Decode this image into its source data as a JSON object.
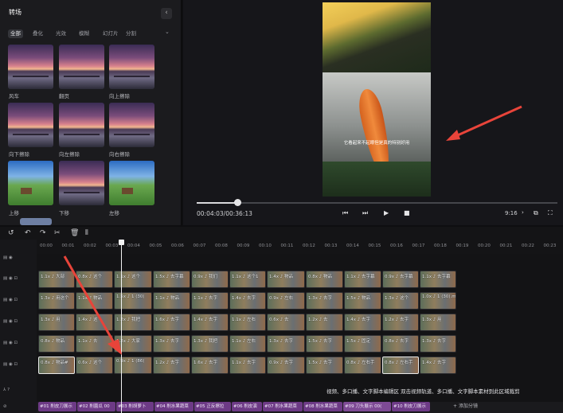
{
  "transitions_panel": {
    "title": "转场",
    "categories": [
      "全部",
      "叠化",
      "光效",
      "模糊",
      "幻灯片",
      "分割"
    ],
    "items": [
      {
        "label": "风车",
        "style": "sunset"
      },
      {
        "label": "翻页",
        "style": "sunset"
      },
      {
        "label": "向上擦除",
        "style": "sunset"
      },
      {
        "label": "向下擦除",
        "style": "sunset"
      },
      {
        "label": "向左擦除",
        "style": "sunset"
      },
      {
        "label": "向右擦除",
        "style": "sunset"
      },
      {
        "label": "上移",
        "style": "green"
      },
      {
        "label": "下移",
        "style": "sunset"
      },
      {
        "label": "左移",
        "style": "green"
      }
    ]
  },
  "preview": {
    "subtitle": "它看起来不起眼但是真的特别好用",
    "progress_fraction": 0.113,
    "time": "00:04:03/00:36:13",
    "ratio": "9:16",
    "arrow_color": "#e8443a"
  },
  "toolbar": {
    "icons": [
      "undo-icon",
      "undo-icon",
      "redo-icon",
      "cut-icon",
      "delete-icon",
      "split-icon"
    ]
  },
  "ruler": {
    "ticks": [
      "00:00",
      "00:01",
      "00:02",
      "00:03",
      "00:04",
      "00:05",
      "00:06",
      "00:07",
      "00:08",
      "00:09",
      "00:10",
      "00:11",
      "00:12",
      "00:13",
      "00:14",
      "00:15",
      "00:16",
      "00:17",
      "00:18",
      "00:19",
      "00:20",
      "00:21",
      "00:22",
      "00:23",
      "00:24"
    ]
  },
  "tracks": [
    {
      "clips": []
    },
    {
      "clips": [
        {
          "text": "1.1x ♪ 大部"
        },
        {
          "text": "0.8x ♪ 这个"
        },
        {
          "text": "1.1x ♪ 这个"
        },
        {
          "text": "1.5x ♪ 去字幕"
        },
        {
          "text": "0.9x ♪ 我们"
        },
        {
          "text": "1.1x ♪ 这个1"
        },
        {
          "text": "1.4x ♪ 物品"
        },
        {
          "text": "0.8x ♪ 物品"
        },
        {
          "text": "1.1x ♪ 去字幕"
        },
        {
          "text": "0.9x ♪ 去字幕"
        },
        {
          "text": "1.1x ♪ 去字幕"
        }
      ]
    },
    {
      "clips": [
        {
          "text": "1.3x ♪ 用这个"
        },
        {
          "text": "1.1x ♪ 物品"
        },
        {
          "text": "1.5x ♪ 1 (30)"
        },
        {
          "text": "1.1x ♪ 物品"
        },
        {
          "text": "1.1x ♪ 去字"
        },
        {
          "text": "1.4x ♪ 去字"
        },
        {
          "text": "0.9x ♪ 左右"
        },
        {
          "text": "1.3x ♪ 去字"
        },
        {
          "text": "1.5x ♪ 物品"
        },
        {
          "text": "1.3x ♪ 这个"
        },
        {
          "text": "1.0x ♪ 1 (30).mp4"
        }
      ]
    },
    {
      "clips": [
        {
          "text": "1.3x ♪ 用"
        },
        {
          "text": "1.4x ♪ 这"
        },
        {
          "text": "1.2x ♪ 我把"
        },
        {
          "text": "1.6x ♪ 去字"
        },
        {
          "text": "1.4x ♪ 去字"
        },
        {
          "text": "1.1x ♪ 左右"
        },
        {
          "text": "0.6x ♪ 去"
        },
        {
          "text": "1.2x ♪ 去"
        },
        {
          "text": "1.4x ♪ 去字"
        },
        {
          "text": "1.2x ♪ 去字"
        },
        {
          "text": "1.3x ♪ 用"
        }
      ]
    },
    {
      "clips": [
        {
          "text": "0.8x ♪ 物品"
        },
        {
          "text": "1.1x ♪ 去"
        },
        {
          "text": "1.2x ♪ 大家"
        },
        {
          "text": "1.3x ♪ 去字"
        },
        {
          "text": "1.3x ♪ 我把"
        },
        {
          "text": "1.1x ♪ 左右"
        },
        {
          "text": "1.3x ♪ 去字"
        },
        {
          "text": "1.5x ♪ 去字"
        },
        {
          "text": "1.5x ♪ 固定"
        },
        {
          "text": "0.8x ♪ 去字"
        },
        {
          "text": "1.3x ♪ 去字"
        }
      ]
    },
    {
      "clips": [
        {
          "text": "0.8x ♪ 物品#"
        },
        {
          "text": "0.6x ♪ 这个"
        },
        {
          "text": "0.9x ♪ 1 (86)"
        },
        {
          "text": "1.2x ♪ 去字"
        },
        {
          "text": "1.6x ♪ 去字"
        },
        {
          "text": "1.1x ♪ 去字"
        },
        {
          "text": "0.9x ♪ 去字"
        },
        {
          "text": "1.5x ♪ 去字"
        },
        {
          "text": "0.8x ♪ 左右手"
        },
        {
          "text": "0.8x ♪ 左右手"
        },
        {
          "text": "1.4x ♪ 去字"
        }
      ]
    }
  ],
  "segments": [
    "#01 削皮刀展示",
    "#02 削菌瓜 00",
    "#03 削胡萝卜",
    "#04 削水果蔬菜",
    "#05 正反擦拉",
    "#06 削皮演",
    "#07 削水果蔬菜",
    "#08 削水果蔬菜",
    "#09 刀头展示 00(",
    "#10 削皮刀展示"
  ],
  "add_segment": "添加分镜",
  "hint": "视频、多口播、文字脚本编辑区 双击视频轨道、多口播、文字脚本素材到此区域裁剪"
}
